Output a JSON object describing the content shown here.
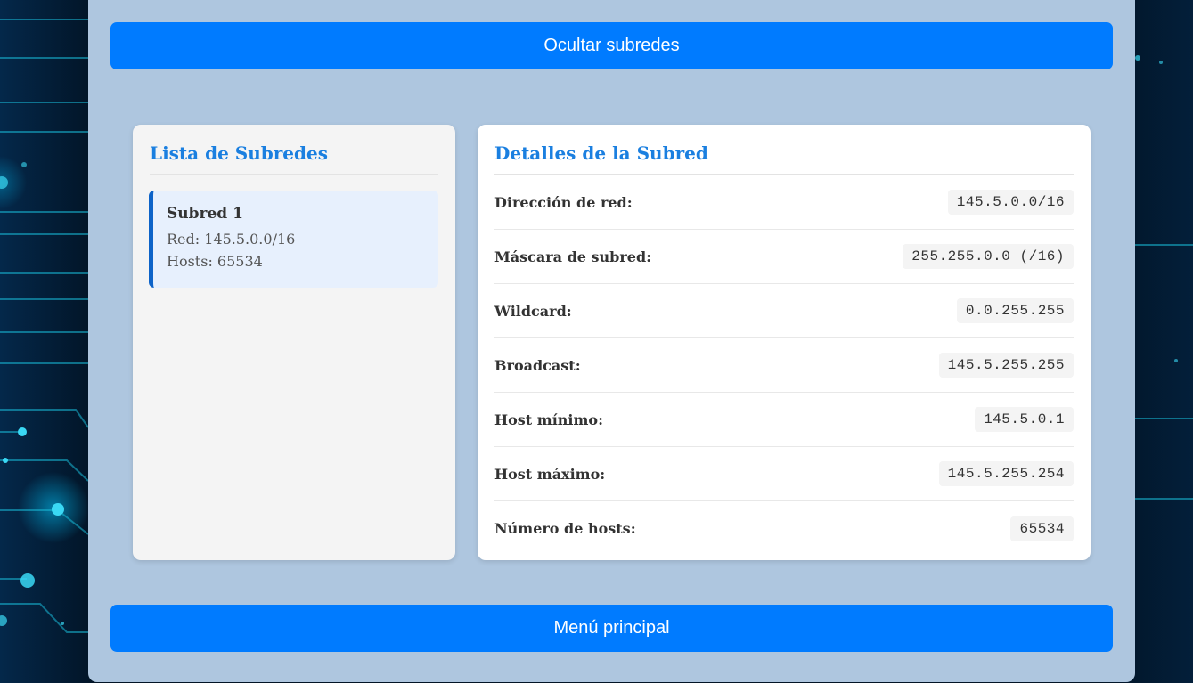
{
  "buttons": {
    "hide_subnets": "Ocultar subredes",
    "main_menu": "Menú principal"
  },
  "subnet_list": {
    "title": "Lista de Subredes",
    "items": [
      {
        "name": "Subred 1",
        "network_line": "Red: 145.5.0.0/16",
        "hosts_line": "Hosts: 65534"
      }
    ]
  },
  "subnet_details": {
    "title": "Detalles de la Subred",
    "rows": [
      {
        "label": "Dirección de red:",
        "value": "145.5.0.0/16"
      },
      {
        "label": "Máscara de subred:",
        "value": "255.255.0.0 (/16)"
      },
      {
        "label": "Wildcard:",
        "value": "0.0.255.255"
      },
      {
        "label": "Broadcast:",
        "value": "145.5.255.255"
      },
      {
        "label": "Host mínimo:",
        "value": "145.5.0.1"
      },
      {
        "label": "Host máximo:",
        "value": "145.5.255.254"
      },
      {
        "label": "Número de hosts:",
        "value": "65534"
      }
    ]
  },
  "colors": {
    "primary_button": "#007bff",
    "panel_background": "#aec6df",
    "card_title": "#1a7fe0",
    "selected_item_border": "#0d63c8",
    "selected_item_background": "#e7f0fd"
  }
}
